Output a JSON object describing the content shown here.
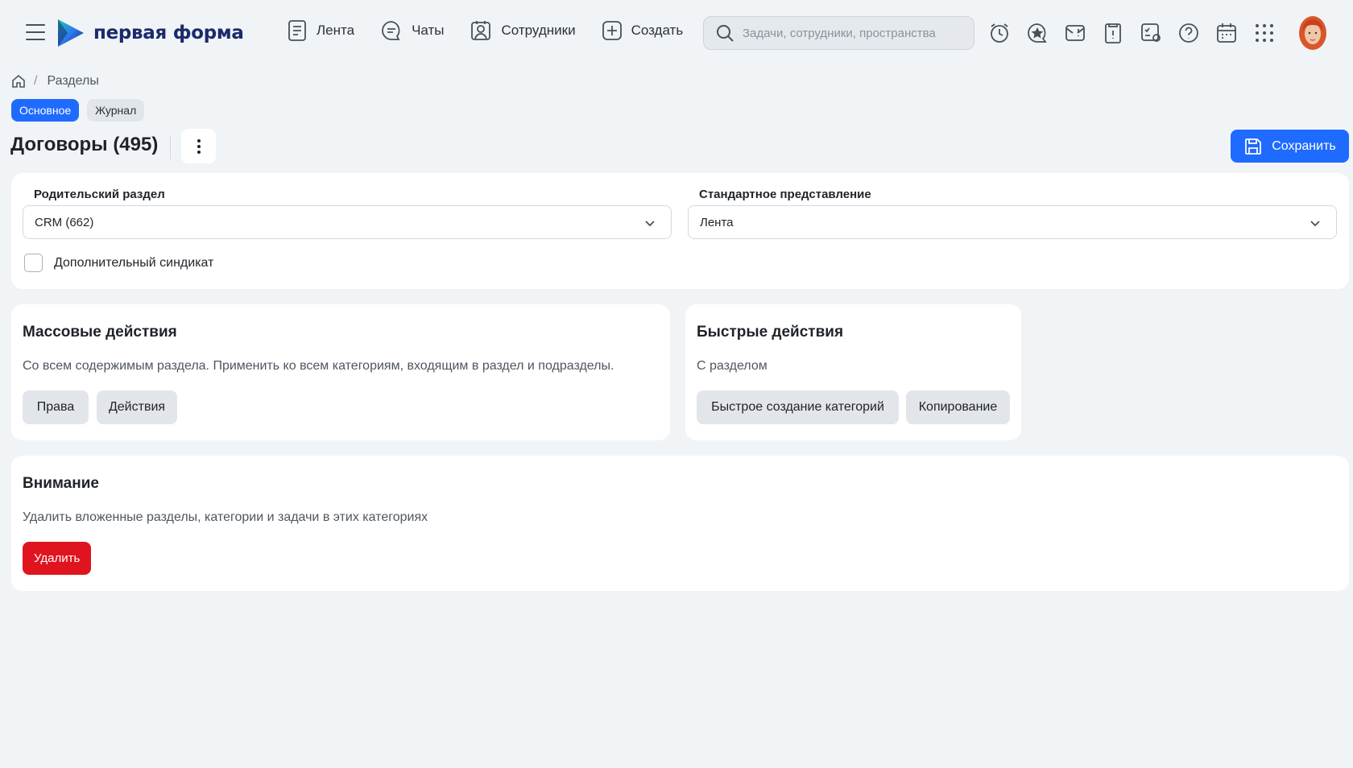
{
  "app": {
    "logo_text": "первая форма"
  },
  "nav": {
    "items": [
      {
        "label": "Лента",
        "icon": "feed-icon"
      },
      {
        "label": "Чаты",
        "icon": "chat-icon"
      },
      {
        "label": "Сотрудники",
        "icon": "employees-icon"
      },
      {
        "label": "Создать",
        "icon": "plus-square-icon"
      }
    ]
  },
  "search": {
    "placeholder": "Задачи, сотрудники, пространства",
    "value": ""
  },
  "toolbar_icons": [
    "alarm-clock-icon",
    "star-chat-icon",
    "mail-alert-icon",
    "important-doc-icon",
    "tasks-settings-icon",
    "help-icon",
    "calendar-icon",
    "apps-grid-icon"
  ],
  "breadcrumb": {
    "items": [
      "Разделы"
    ]
  },
  "tabs": [
    {
      "label": "Основное",
      "active": true
    },
    {
      "label": "Журнал",
      "active": false
    }
  ],
  "page": {
    "title": "Договоры (495)",
    "save_label": "Сохранить"
  },
  "settings": {
    "parent_label": "Родительский раздел",
    "parent_value": "CRM (662)",
    "view_label": "Стандартное представление",
    "view_value": "Лента",
    "syndicate_label": "Дополнительный синдикат",
    "syndicate_checked": false
  },
  "mass_actions": {
    "title": "Массовые действия",
    "description": "Со всем содержимым раздела. Применить ко всем категориям, входящим в раздел и подразделы.",
    "buttons": [
      "Права",
      "Действия"
    ]
  },
  "quick_actions": {
    "title": "Быстрые действия",
    "description": "С разделом",
    "buttons": [
      "Быстрое создание категорий",
      "Копирование"
    ]
  },
  "warning": {
    "title": "Внимание",
    "description": "Удалить вложенные разделы, категории и задачи в этих категориях",
    "delete_label": "Удалить"
  },
  "colors": {
    "accent": "#1f6bff",
    "danger": "#e0141f",
    "background": "#f1f4f7"
  }
}
